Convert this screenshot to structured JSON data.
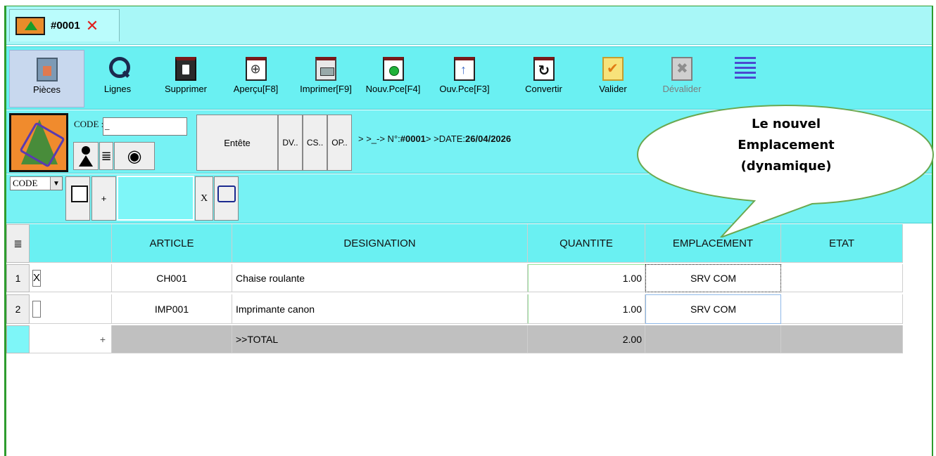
{
  "tab": {
    "title": "#0001",
    "close": "✕"
  },
  "toolbar": {
    "pieces": "Pièces",
    "lignes": "Lignes",
    "supprimer": "Supprimer",
    "apercu": "Aperçu[F8]",
    "imprimer": "Imprimer[F9]",
    "nouv_pce": "Nouv.Pce[F4]",
    "ouv_pce": "Ouv.Pce[F3]",
    "convertir": "Convertir",
    "valider": "Valider",
    "devalider": "Dévalider"
  },
  "header": {
    "code_label": "CODE :",
    "code_value": "_",
    "entete": "Entête",
    "dv": "DV..",
    "cs": "CS..",
    "op": "OP..",
    "info_prefix": "> >_-> N°:",
    "numero": "#0001",
    "info_mid": "> >DATE:",
    "date": "26/04/2026"
  },
  "line_entry": {
    "code_select": "CODE",
    "plus": "+",
    "x": "X"
  },
  "grid": {
    "columns": [
      "ARTICLE",
      "DESIGNATION",
      "QUANTITE",
      "EMPLACEMENT",
      "ETAT"
    ],
    "rows": [
      {
        "num": "1",
        "check": "X",
        "article": "CH001",
        "designation": "Chaise roulante",
        "quantite": "1.00",
        "emplacement": "SRV COM",
        "etat": ""
      },
      {
        "num": "2",
        "check": "",
        "article": "IMP001",
        "designation": "Imprimante canon",
        "quantite": "1.00",
        "emplacement": "SRV COM",
        "etat": ""
      }
    ],
    "total": {
      "label": ">>TOTAL",
      "quantite": "2.00"
    }
  },
  "callout": {
    "line1": "Le nouvel",
    "line2": "Emplacement",
    "line3": "(dynamique)"
  },
  "colors": {
    "cyan": "#6af0f2",
    "green_border": "#2e9c2e",
    "tab_close": "#e0201c"
  }
}
